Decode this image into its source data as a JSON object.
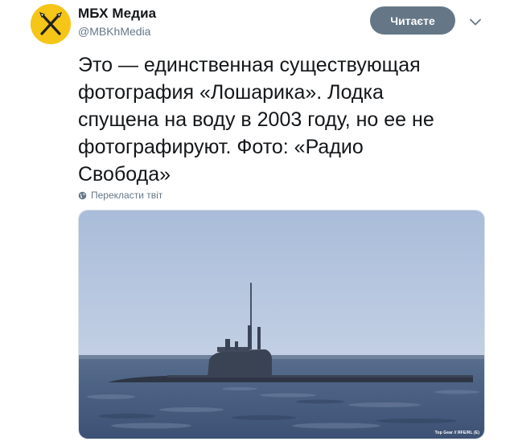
{
  "tweet": {
    "account": {
      "display_name": "МБХ Медиа",
      "handle": "@MBKhMedia",
      "avatar_icon": "crossed-pens-logo"
    },
    "follow_button": "Читаєте",
    "menu_icon": "chevron-down-icon",
    "text": "Это — единственная существующая\nфотография «Лошарика». Лодка\nспущена на воду в 2003 году, но ее не\nфотографируют. Фото: «Радио\nСвобода»",
    "translate": {
      "icon": "globe-icon",
      "label": "Перекласти твіт"
    },
    "media": {
      "credit": "Top Gear // RFE/RL (E)"
    }
  },
  "colors": {
    "avatar_bg": "#f5c518",
    "button_bg": "#657786",
    "secondary_text": "#657786",
    "primary_text": "#14171a"
  }
}
